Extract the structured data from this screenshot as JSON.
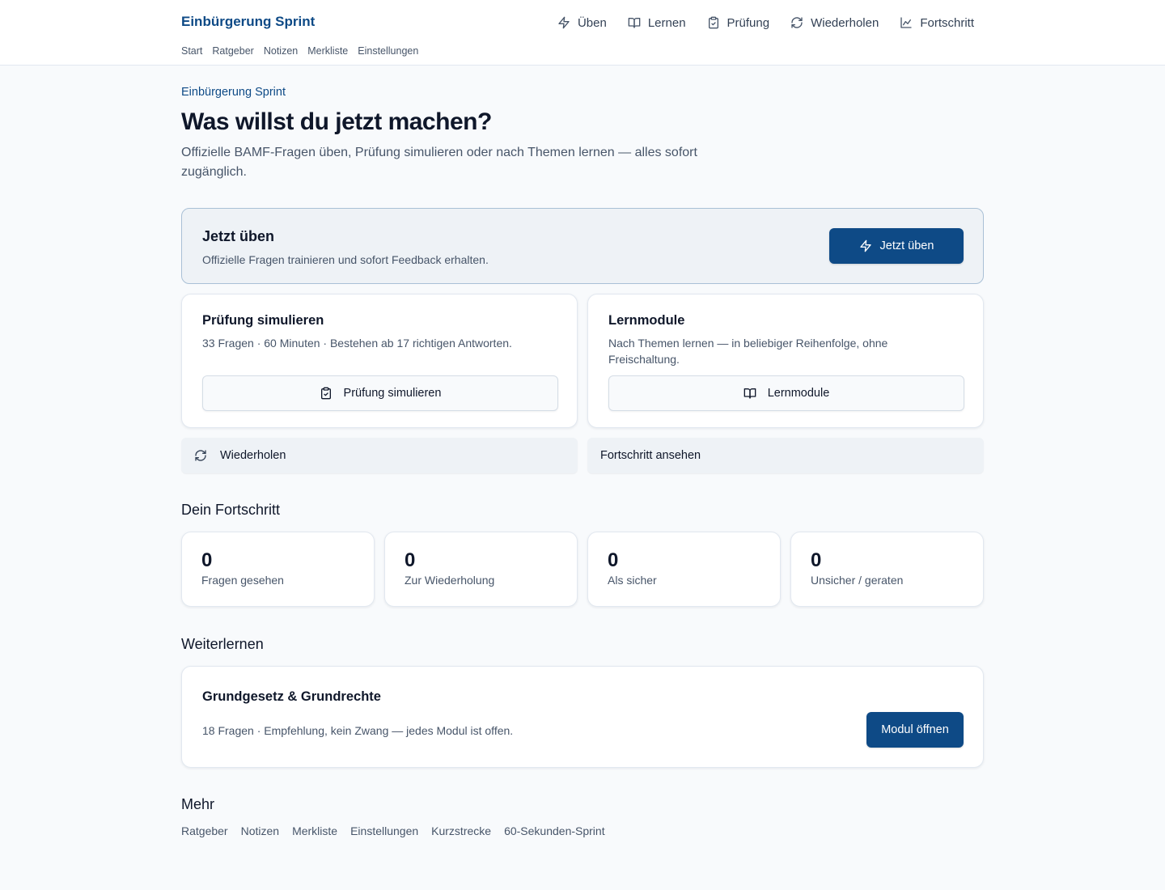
{
  "header": {
    "brand": "Einbürgerung Sprint",
    "subnav": [
      "Start",
      "Ratgeber",
      "Notizen",
      "Merkliste",
      "Einstellungen"
    ],
    "nav": [
      {
        "label": "Üben",
        "icon": "zap-icon"
      },
      {
        "label": "Lernen",
        "icon": "book-open-icon"
      },
      {
        "label": "Prüfung",
        "icon": "clipboard-check-icon"
      },
      {
        "label": "Wiederholen",
        "icon": "refresh-icon"
      },
      {
        "label": "Fortschritt",
        "icon": "chart-line-icon"
      }
    ]
  },
  "intro": {
    "eyebrow": "Einbürgerung Sprint",
    "title": "Was willst du jetzt machen?",
    "lead": "Offizielle BAMF-Fragen üben, Prüfung simulieren oder nach Themen lernen — alles sofort zugänglich."
  },
  "hero": {
    "title": "Jetzt üben",
    "description": "Offizielle Fragen trainieren und sofort Feedback erhalten.",
    "button": "Jetzt üben"
  },
  "cards": [
    {
      "title": "Prüfung simulieren",
      "description": "33 Fragen · 60 Minuten · Bestehen ab 17 richtigen Antworten.",
      "button": "Prüfung simulieren"
    },
    {
      "title": "Lernmodule",
      "description": "Nach Themen lernen — in beliebiger Reihenfolge, ohne Freischaltung.",
      "button": "Lernmodule"
    }
  ],
  "secondary": {
    "repeat": "Wiederholen",
    "progress": "Fortschritt ansehen"
  },
  "progress": {
    "title": "Dein Fortschritt",
    "stats": [
      {
        "value": "0",
        "label": "Fragen gesehen"
      },
      {
        "value": "0",
        "label": "Zur Wiederholung"
      },
      {
        "value": "0",
        "label": "Als sicher"
      },
      {
        "value": "0",
        "label": "Unsicher / geraten"
      }
    ]
  },
  "continue": {
    "title": "Weiterlernen",
    "module_title": "Grundgesetz & Grundrechte",
    "module_desc": "18 Fragen · Empfehlung, kein Zwang — jedes Modul ist offen.",
    "button": "Modul öffnen"
  },
  "more": {
    "title": "Mehr",
    "links": [
      "Ratgeber",
      "Notizen",
      "Merkliste",
      "Einstellungen",
      "Kurzstrecke",
      "60-Sekunden-Sprint"
    ]
  },
  "colors": {
    "accent": "#0e4a86",
    "hero_bg": "#eef2f6",
    "hero_border": "#a9c0d6",
    "page_bg": "#f8fafc"
  }
}
